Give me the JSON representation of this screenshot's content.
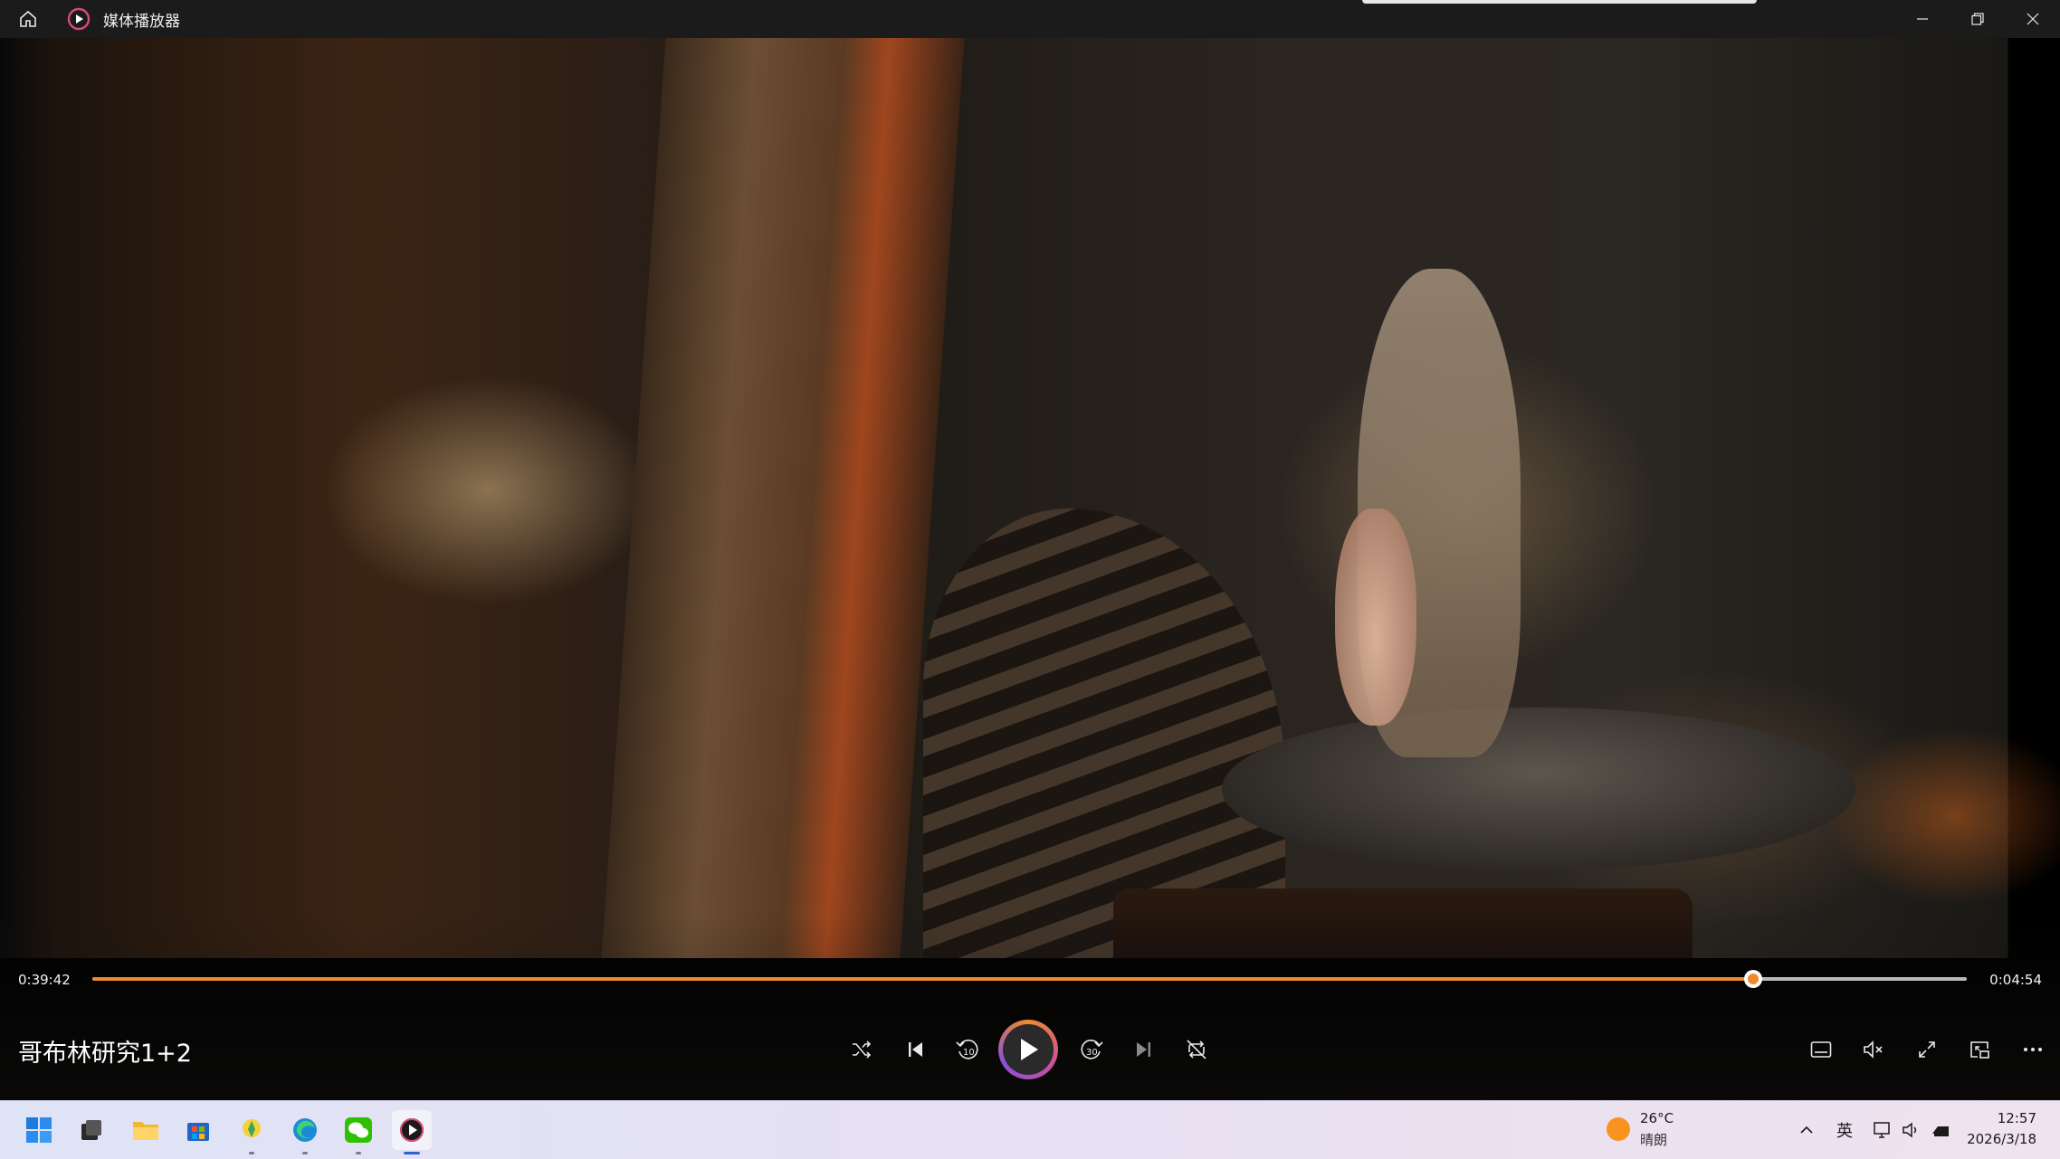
{
  "window": {
    "title": "媒体播放器",
    "icons": [
      "home-icon",
      "app-icon",
      "minimize-icon",
      "restore-icon",
      "close-icon"
    ]
  },
  "player": {
    "media_title": "哥布林研究1+2",
    "current_time": "0:39:42",
    "duration": "0:04:54",
    "progress_fraction": 0.886,
    "accent_color": "#f08a2c",
    "controls": [
      "shuffle-icon",
      "previous-icon",
      "rewind-10-icon",
      "play-icon",
      "forward-30-icon",
      "next-icon",
      "repeat-off-icon"
    ],
    "right_controls": [
      "subtitles-icon",
      "mute-icon",
      "fullscreen-icon",
      "mini-player-icon",
      "more-icon"
    ],
    "rewind_label": "10",
    "forward_label": "30"
  },
  "taskbar": {
    "apps": [
      "start-icon",
      "taskview-icon",
      "file-explorer-icon",
      "store-icon",
      "app-yellow-icon",
      "edge-icon",
      "wechat-icon",
      "media-player-icon"
    ],
    "weather": {
      "temp": "26°C",
      "desc": "晴朗"
    },
    "tray": {
      "ime": "英"
    },
    "clock": {
      "time": "12:57",
      "date": "2026/3/18"
    }
  }
}
